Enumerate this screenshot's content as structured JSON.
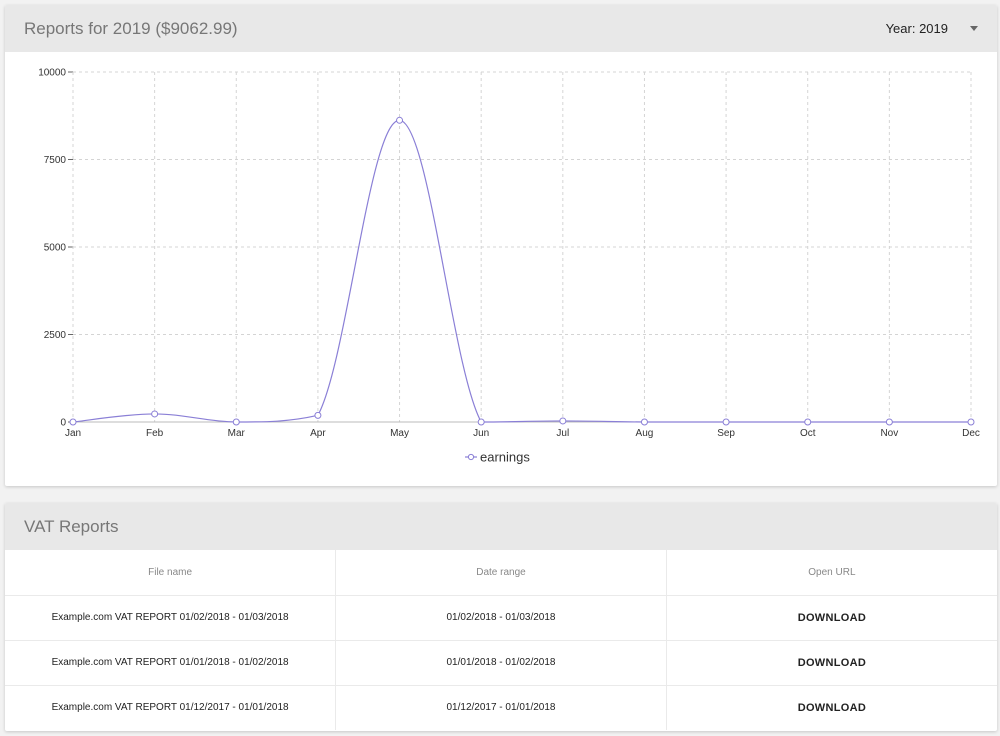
{
  "reports": {
    "title": "Reports for 2019 ($9062.99)",
    "year_select_label": "Year: 2019"
  },
  "chart_data": {
    "type": "line",
    "categories": [
      "Jan",
      "Feb",
      "Mar",
      "Apr",
      "May",
      "Jun",
      "Jul",
      "Aug",
      "Sep",
      "Oct",
      "Nov",
      "Dec"
    ],
    "series": [
      {
        "name": "earnings",
        "values": [
          0,
          230,
          0,
          190,
          8620,
          0,
          30,
          0,
          0,
          0,
          0,
          0
        ]
      }
    ],
    "yticks": [
      "0",
      "2500",
      "5000",
      "7500",
      "10000"
    ],
    "ylim": [
      0,
      10000
    ],
    "grid": true,
    "legend_position": "bottom-center",
    "line_color": "#8a7fd6",
    "grid_color": "#d4d4d4"
  },
  "vat": {
    "title": "VAT Reports",
    "columns": [
      "File name",
      "Date range",
      "Open URL"
    ],
    "rows": [
      {
        "file": "Example.com VAT REPORT 01/02/2018 - 01/03/2018",
        "range": "01/02/2018 - 01/03/2018",
        "action": "DOWNLOAD"
      },
      {
        "file": "Example.com VAT REPORT 01/01/2018 - 01/02/2018",
        "range": "01/01/2018 - 01/02/2018",
        "action": "DOWNLOAD"
      },
      {
        "file": "Example.com VAT REPORT 01/12/2017 - 01/01/2018",
        "range": "01/12/2017 - 01/01/2018",
        "action": "DOWNLOAD"
      }
    ]
  }
}
